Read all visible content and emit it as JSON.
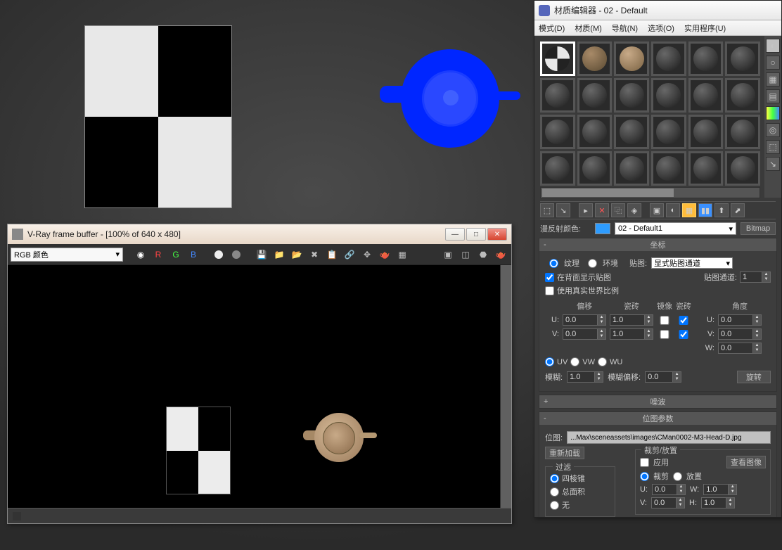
{
  "viewport": {},
  "vray": {
    "title": "V-Ray frame buffer - [100% of 640 x 480]",
    "channel_dropdown": "RGB 颜色",
    "rgb_buttons": {
      "r": "R",
      "g": "G",
      "b": "B"
    }
  },
  "matedit": {
    "title": "材质编辑器 - 02 - Default",
    "menu": {
      "mode": "模式(D)",
      "material": "材质(M)",
      "nav": "导航(N)",
      "options": "选项(O)",
      "util": "实用程序(U)"
    },
    "name_row": {
      "label": "漫反射颜色:",
      "name": "02 - Default1",
      "bitmap_btn": "Bitmap"
    },
    "coord_rollout": {
      "title": "坐标",
      "texture": "纹理",
      "environment": "环境",
      "map_label": "贴图:",
      "map_dropdown": "显式贴图通道",
      "show_backface": "在背面显示贴图",
      "map_channel_label": "贴图通道:",
      "map_channel_val": "1",
      "real_world": "使用真实世界比例",
      "headers": {
        "offset": "偏移",
        "tile": "瓷砖",
        "mirror": "镜像",
        "tile2": "瓷砖",
        "angle": "角度"
      },
      "u": "U:",
      "v": "V:",
      "w": "W:",
      "u_offset": "0.0",
      "v_offset": "0.0",
      "u_tile": "1.0",
      "v_tile": "1.0",
      "u_angle": "0.0",
      "v_angle": "0.0",
      "w_angle": "0.0",
      "uv": "UV",
      "vw": "VW",
      "wu": "WU",
      "blur_label": "模糊:",
      "blur_val": "1.0",
      "blur_offset_label": "模糊偏移:",
      "blur_offset_val": "0.0",
      "rotate": "旋转"
    },
    "noise_rollout": {
      "title": "噪波"
    },
    "bitmap_rollout": {
      "title": "位图参数",
      "bitmap_label": "位图:",
      "path": "...Max\\sceneassets\\images\\CMan0002-M3-Head-D.jpg",
      "reload": "重新加载",
      "filter_title": "过滤",
      "filter_pyramid": "四棱锥",
      "filter_sat": "总面积",
      "filter_none": "无",
      "crop_title": "裁剪/放置",
      "apply": "应用",
      "view_image": "查看图像",
      "crop": "裁剪",
      "place": "放置",
      "u_label": "U:",
      "v_label": "V:",
      "w_label": "W:",
      "h_label": "H:",
      "u_val": "0.0",
      "v_val": "0.0",
      "w_val": "1.0",
      "h_val": "1.0"
    }
  }
}
